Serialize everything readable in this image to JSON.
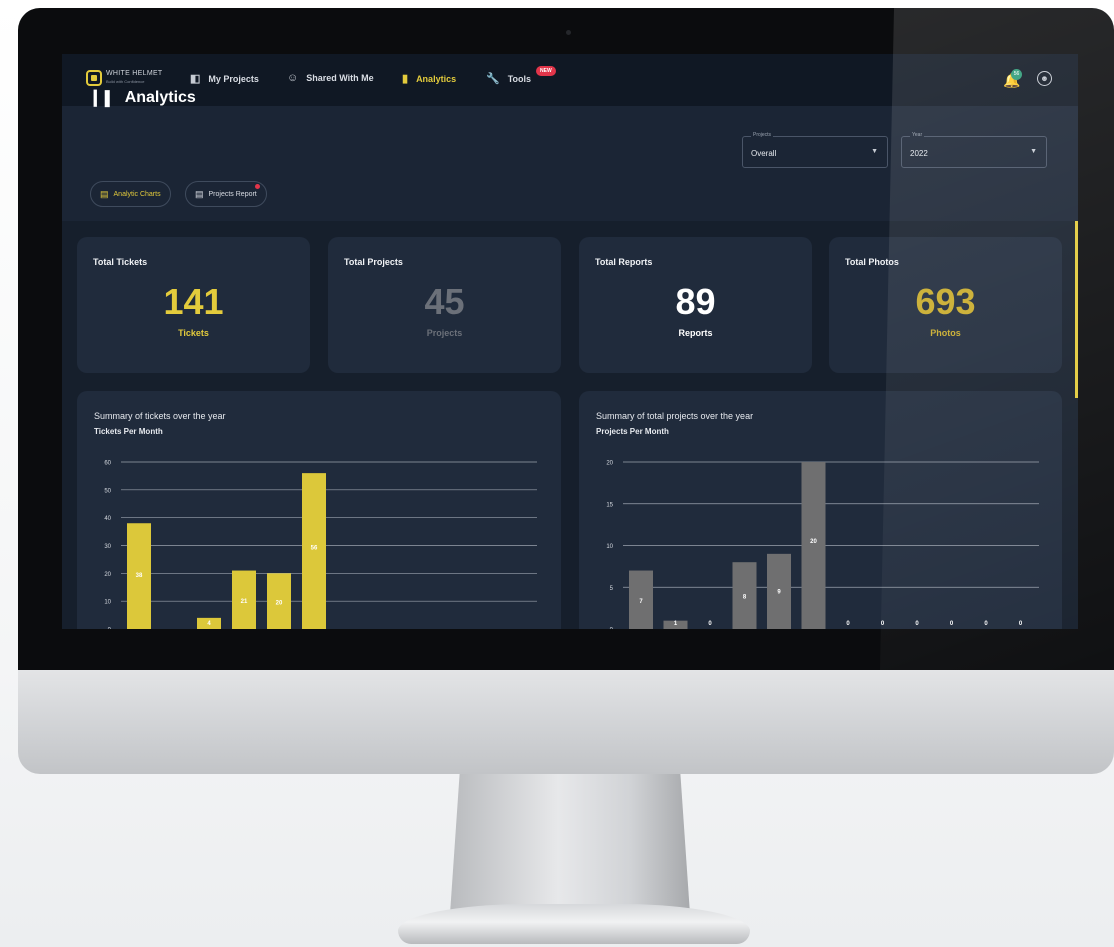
{
  "nav": {
    "logo_text": "WHITE HELMET",
    "logo_tagline": "Build with Confidence",
    "items": [
      {
        "label": "My Projects",
        "icon": "briefcase-icon"
      },
      {
        "label": "Shared With Me",
        "icon": "people-icon"
      },
      {
        "label": "Analytics",
        "icon": "bar-chart-icon",
        "active": true
      },
      {
        "label": "Tools",
        "icon": "wrench-icon",
        "badge": "NEW"
      }
    ],
    "notification_count": "56"
  },
  "page": {
    "title": "Analytics",
    "tabs": [
      {
        "label": "Analytic Charts",
        "active": true
      },
      {
        "label": "Projects Report",
        "dot": true
      }
    ],
    "filters": {
      "projects": {
        "label": "Projects",
        "value": "Overall"
      },
      "year": {
        "label": "Year",
        "value": "2022"
      }
    }
  },
  "stats": [
    {
      "title": "Total Tickets",
      "value": "141",
      "unit": "Tickets",
      "color": "#e3cb3c"
    },
    {
      "title": "Total Projects",
      "value": "45",
      "unit": "Projects",
      "color": "#6b7079"
    },
    {
      "title": "Total Reports",
      "value": "89",
      "unit": "Reports",
      "color": "#ffffff"
    },
    {
      "title": "Total Photos",
      "value": "693",
      "unit": "Photos",
      "color": "#c9ac2c"
    }
  ],
  "colors": {
    "accent": "#e3cb3c",
    "bar_gray": "#6f6f70",
    "background": "#161f2c",
    "card": "#202b3c"
  },
  "chart_data": [
    {
      "type": "bar",
      "title": "Summary of tickets over the year",
      "subtitle": "Tickets Per Month",
      "color": "#dcc83a",
      "yticks": [
        0,
        10,
        20,
        30,
        40,
        50,
        60
      ],
      "ylim": [
        0,
        60
      ],
      "grid": true,
      "values": [
        38,
        null,
        4,
        21,
        20,
        56
      ],
      "labels": [
        "38",
        "",
        "4",
        "21",
        "20",
        "56"
      ]
    },
    {
      "type": "bar",
      "title": "Summary of total projects over the year",
      "subtitle": "Projects Per Month",
      "color": "#6f6f70",
      "yticks": [
        0,
        5,
        10,
        15,
        20
      ],
      "ylim": [
        0,
        20
      ],
      "grid": true,
      "values": [
        7,
        1,
        0,
        8,
        9,
        20,
        0,
        0,
        0,
        0,
        0,
        0
      ],
      "labels": [
        "7",
        "1",
        "0",
        "8",
        "9",
        "20",
        "0",
        "0",
        "0",
        "0",
        "0",
        "0"
      ]
    }
  ]
}
